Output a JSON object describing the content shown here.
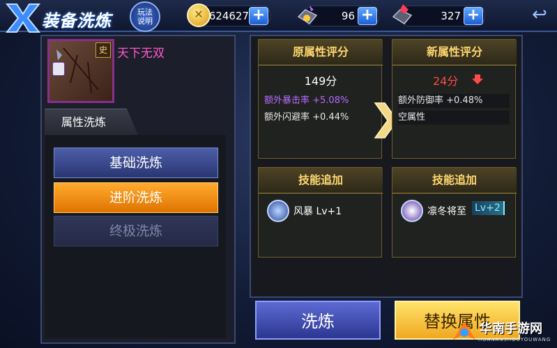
{
  "header": {
    "title": "装备洗炼",
    "help_label": "玩法\n说明",
    "gold_value": "624627",
    "gem_value": "96",
    "crystal_value": "327"
  },
  "item": {
    "name": "天下无双",
    "badge": "史"
  },
  "left": {
    "tab_label": "属性洗炼",
    "basic_refine": "基础洗炼",
    "advanced_refine": "进阶洗炼",
    "ultimate_refine": "终极洗炼"
  },
  "old_stats": {
    "header": "原属性评分",
    "score": "149分",
    "attrs": [
      "额外暴击率 +5.08%",
      "额外闪避率 +0.44%"
    ]
  },
  "new_stats": {
    "header": "新属性评分",
    "score": "24分",
    "attrs": [
      "额外防御率 +0.48%",
      "空属性"
    ]
  },
  "skills": {
    "header_old": "技能追加",
    "header_new": "技能追加",
    "old_skill": "风暴 Lv+1",
    "new_skill_name": "凛冬将至",
    "new_skill_level": "Lv+2"
  },
  "actions": {
    "refine": "洗炼",
    "replace": "替换属性"
  },
  "watermark": {
    "text": "华南手游网",
    "sub": "HUANANSHOUYOUWANG"
  },
  "colors": {
    "accent_gold": "#ffd771",
    "item_name": "#ff58c8",
    "purple_attr": "#b86bff",
    "score_down": "#ff4a4a",
    "advanced_btn": "#f08a14"
  }
}
